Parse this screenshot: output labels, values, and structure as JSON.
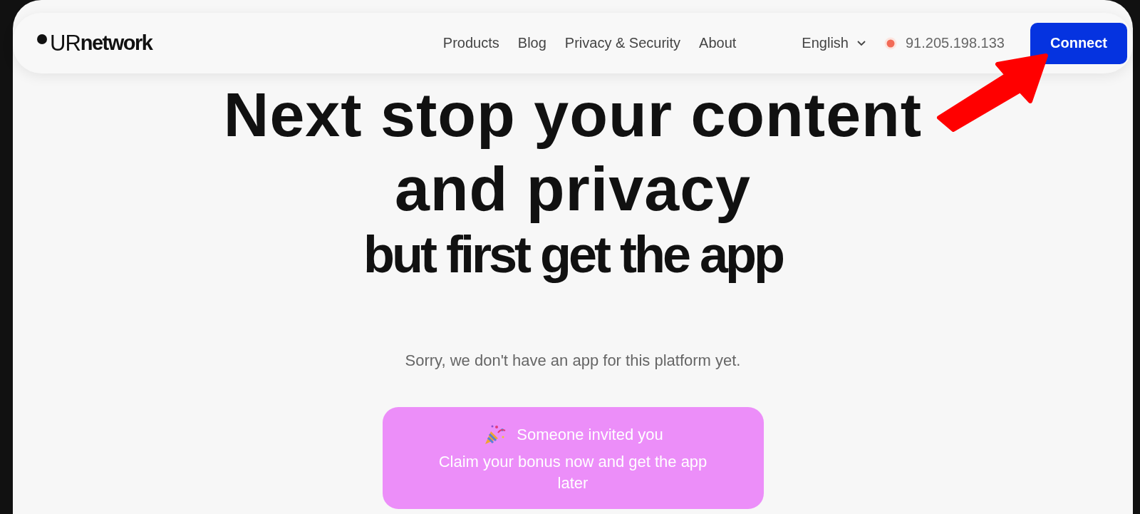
{
  "header": {
    "logo": {
      "light": "UR",
      "bold": "network"
    },
    "nav": [
      {
        "label": "Products"
      },
      {
        "label": "Blog"
      },
      {
        "label": "Privacy & Security"
      },
      {
        "label": "About"
      }
    ],
    "language": "English",
    "ip_address": "91.205.198.133",
    "connect_button": "Connect"
  },
  "headline": [
    "Next stop your content",
    "and privacy"
  ],
  "subheadline": "but first get the app",
  "notice": "Sorry, we don't have an app for this platform yet.",
  "invite_card": {
    "title": "Someone invited you",
    "text": "Claim your bonus now and get the app later"
  }
}
